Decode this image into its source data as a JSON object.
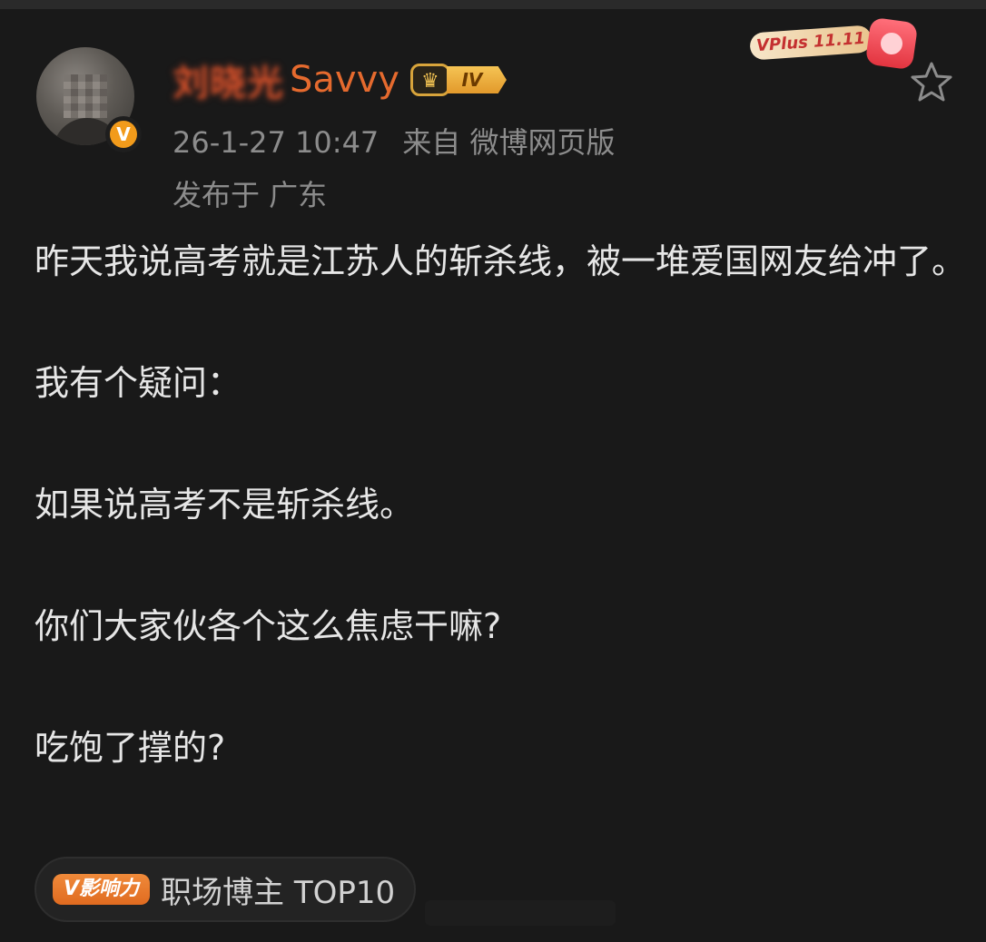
{
  "author": {
    "name_blurred": "刘晓光",
    "name_suffix": "Savvy",
    "level_badge": "IV",
    "verified_badge": "V",
    "avatar_icon": "avatar-photo"
  },
  "meta": {
    "time": "26-1-27 10:47",
    "source": "来自 微博网页版",
    "location": "发布于 广东"
  },
  "sticker": {
    "text": "VPlus 11.11"
  },
  "post": {
    "paragraphs": [
      "昨天我说高考就是江苏人的斩杀线，被一堆爱国网友给冲了。",
      "我有个疑问：",
      "如果说高考不是斩杀线。",
      "你们大家伙各个这么焦虑干嘛?",
      "吃饱了撑的?"
    ]
  },
  "influence": {
    "badge": "V影响力",
    "label": "职场博主 TOP10"
  },
  "colors": {
    "background": "#191919",
    "name": "#e56a2e",
    "meta": "#8c8c8c",
    "text": "#e6e6e6",
    "verified": "#f29b1b"
  }
}
